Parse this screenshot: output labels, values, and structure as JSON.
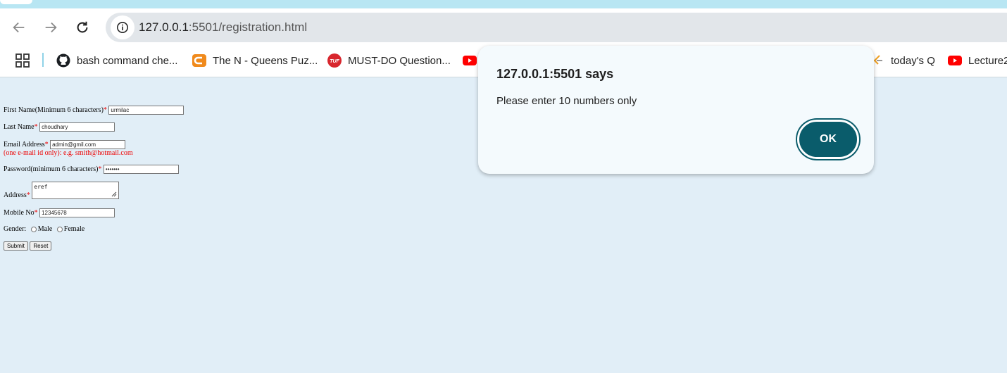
{
  "browser": {
    "url_host": "127.0.0.1",
    "url_rest": ":5501/registration.html",
    "bookmarks": [
      {
        "label": "bash command che...",
        "icon": "github-icon"
      },
      {
        "label": "The N - Queens Puz...",
        "icon": "codingninjas-icon"
      },
      {
        "label": "MUST-DO Question...",
        "icon": "tuf-icon"
      },
      {
        "label": "",
        "icon": "youtube-icon"
      },
      {
        "label": "today's Q",
        "icon": "leetcode-icon"
      },
      {
        "label": "Lecture2",
        "icon": "youtube-icon"
      }
    ]
  },
  "form": {
    "first_name_label": "First Name(Minimum 6 characters)",
    "first_name_value": "urmilac",
    "last_name_label": "Last Name",
    "last_name_value": "choudhary",
    "email_label": "Email Address",
    "email_value": "admin@gmil.com",
    "email_hint": "(one e-mail id only): e.g. smith@hotmail.com",
    "password_label": "Password(minimum 6 characters)",
    "password_value": "•••••••",
    "address_label": "Address",
    "address_value": "eref",
    "mobile_label": "Mobile No",
    "mobile_value": "12345678",
    "gender_label": "Gender:",
    "gender_male": "Male",
    "gender_female": "Female",
    "submit_label": "Submit",
    "reset_label": "Reset",
    "required_mark": "*"
  },
  "dialog": {
    "title": "127.0.0.1:5501 says",
    "message": "Please enter 10 numbers only",
    "ok_label": "OK"
  },
  "colors": {
    "page_background": "#e1eef7",
    "required": "#ee0000",
    "ok_button": "#0a5c6b"
  }
}
